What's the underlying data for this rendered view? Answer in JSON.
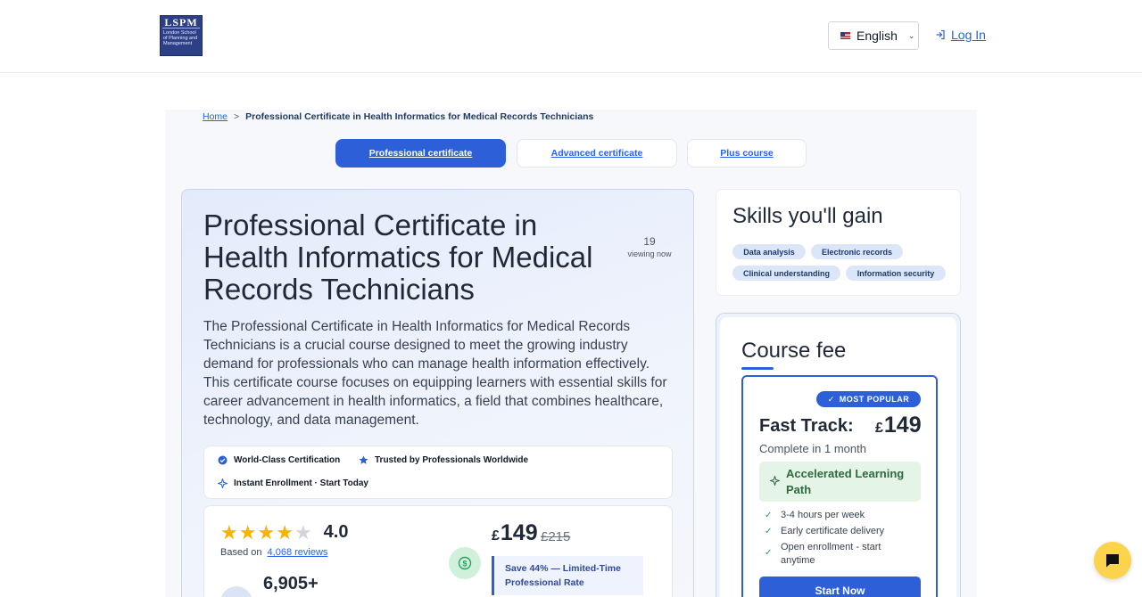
{
  "header": {
    "logo": {
      "big": "LSPM",
      "small": "London School of Planning and Management"
    },
    "language": "English",
    "login": "Log In"
  },
  "breadcrumb": {
    "home": "Home",
    "sep": ">",
    "current": "Professional Certificate in Health Informatics for Medical Records Technicians"
  },
  "tabs": [
    {
      "label": "Professional certificate",
      "active": true
    },
    {
      "label": "Advanced certificate",
      "active": false
    },
    {
      "label": "Plus course",
      "active": false
    }
  ],
  "course": {
    "title": "Professional Certificate in Health Informatics for Medical Records Technicians",
    "viewers_count": "19",
    "viewers_label": "viewing now",
    "description": "The Professional Certificate in Health Informatics for Medical Records Technicians is a crucial course designed to meet the growing industry demand for professionals who can manage health information effectively. This certificate course focuses on equipping learners with essential skills for career advancement in health informatics, a field that combines healthcare, technology, and data management."
  },
  "badges": [
    {
      "label": "World-Class Certification",
      "icon": "check-badge-icon"
    },
    {
      "label": "Trusted by Professionals Worldwide",
      "icon": "star-icon"
    },
    {
      "label": "Instant Enrollment · Start Today",
      "icon": "sparkle-icon"
    }
  ],
  "rating": {
    "value": "4.0",
    "stars": 4,
    "max_stars": 5,
    "based_on": "Based on",
    "reviews_link": "4,068 reviews",
    "learners": "6,905+"
  },
  "pricing": {
    "currency": "£",
    "price": "149",
    "old_price": "£215",
    "save_text": "Save 44% — Limited-Time Professional Rate"
  },
  "skills": {
    "title": "Skills you'll gain",
    "items": [
      "Data analysis",
      "Electronic records",
      "Clinical understanding",
      "Information security"
    ]
  },
  "fee": {
    "title": "Course fee",
    "badge": "MOST POPULAR",
    "plan_name": "Fast Track:",
    "currency": "£",
    "price": "149",
    "duration": "Complete in 1 month",
    "path": "Accelerated Learning Path",
    "features": [
      "3-4 hours per week",
      "Early certificate delivery",
      "Open enrollment - start anytime"
    ],
    "cta": "Start Now"
  },
  "colors": {
    "primary": "#2d5fd8",
    "star": "#f5b400",
    "success": "#22a05b",
    "chat": "#fcd34d"
  }
}
